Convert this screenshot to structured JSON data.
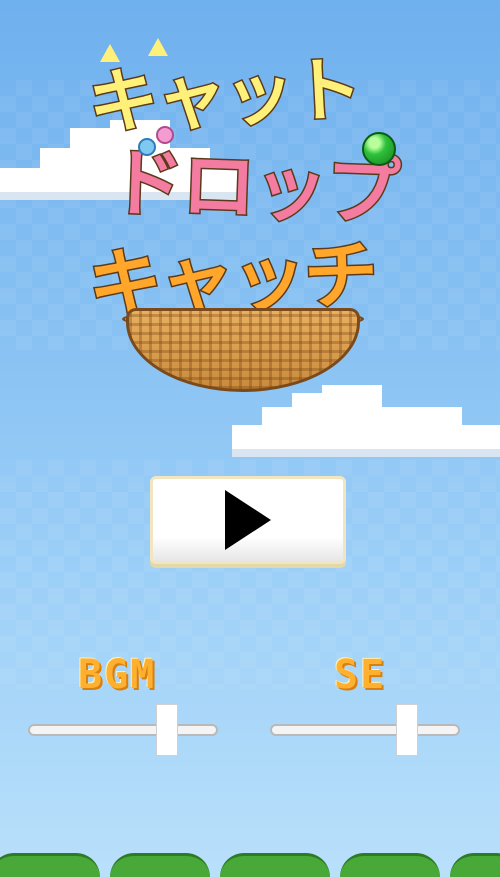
{
  "title": {
    "line1": "キャット",
    "line2": "ドロップ",
    "line3": "キャッチ"
  },
  "play_button": {
    "icon": "play-icon"
  },
  "sliders": {
    "bgm": {
      "label": "BGM",
      "level": 0.73
    },
    "se": {
      "label": "SE",
      "level": 0.72
    }
  },
  "colors": {
    "sky_top": "#6fb0ee",
    "sky_bottom": "#b9e0fb",
    "title_line1": "#fff07a",
    "title_line2": "#f37ca0",
    "title_line3": "#ffa62b",
    "label": "#ffb02e",
    "bush": "#48a938"
  }
}
